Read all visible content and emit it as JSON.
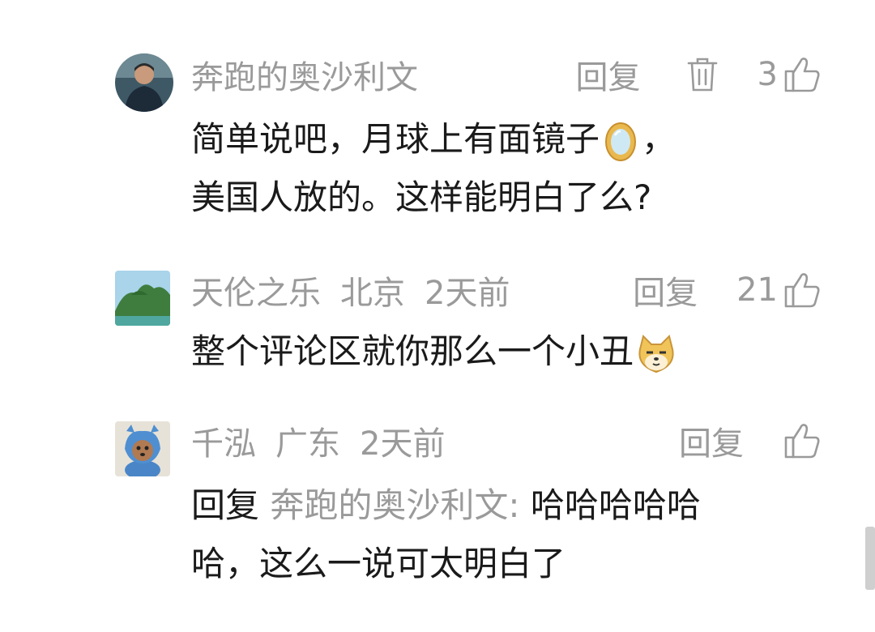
{
  "comments": [
    {
      "name": "奔跑的奥沙利文",
      "reply_label": "回复",
      "like_count": "3",
      "lines": [
        "简单说吧，月球上有面镜子",
        "，",
        "美国人放的。这样能明白了么?"
      ]
    },
    {
      "name": "天伦之乐",
      "location": "北京",
      "time": "2天前",
      "reply_label": "回复",
      "like_count": "21",
      "text": "整个评论区就你那么一个小丑"
    },
    {
      "name": "千泓",
      "location": "广东",
      "time": "2天前",
      "reply_label": "回复",
      "reply_prefix": "回复",
      "reply_target": "奔跑的奥沙利文:",
      "line1": "哈哈哈哈哈",
      "line2": "哈，这么一说可太明白了"
    }
  ],
  "icons": {
    "trash": "trash-icon",
    "thumb": "thumbs-up-icon",
    "mirror": "mirror-emoji",
    "doge": "doge-emoji"
  }
}
